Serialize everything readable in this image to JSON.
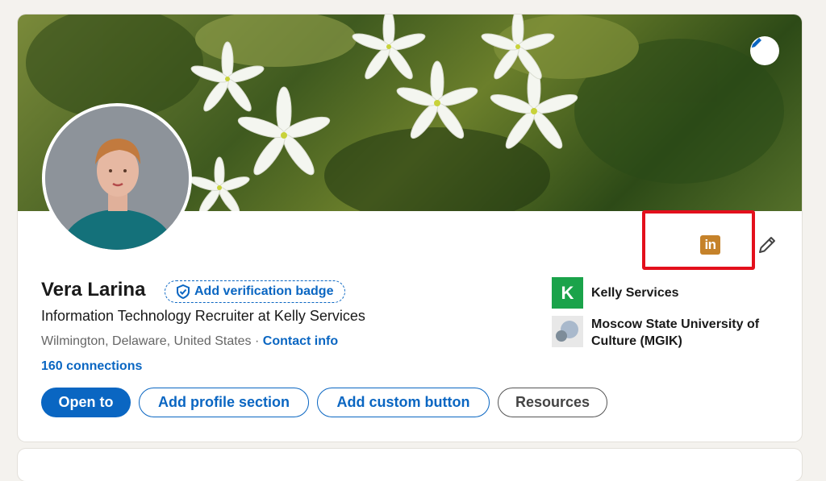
{
  "profile": {
    "name": "Vera Larina",
    "verification_badge_label": "Add verification badge",
    "headline": "Information Technology Recruiter at Kelly Services",
    "location": "Wilmington, Delaware, United States",
    "separator": " · ",
    "contact_info": "Contact info",
    "connections": "160 connections"
  },
  "actions": {
    "open_to": "Open to",
    "add_profile_section": "Add profile section",
    "add_custom_button": "Add custom button",
    "resources": "Resources"
  },
  "organizations": [
    {
      "name": "Kelly Services",
      "logo_letter": "K"
    },
    {
      "name": "Moscow State University of Culture (MGIK)"
    }
  ],
  "linkedin_logo_text": "in",
  "colors": {
    "accent": "#0a66c2",
    "highlight": "#e3101c",
    "linkedin_logo": "#c5822a",
    "kelly_green": "#1aa34a"
  }
}
